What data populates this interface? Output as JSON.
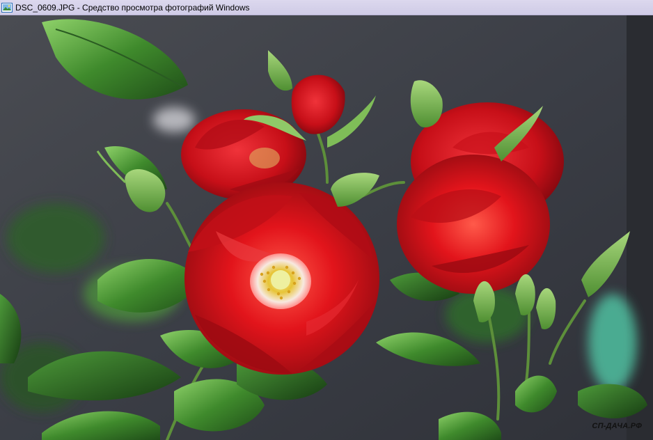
{
  "window": {
    "title": "DSC_0609.JPG - Средство просмотра фотографий Windows",
    "icon": "photo-viewer-icon"
  },
  "photo": {
    "watermark": "СП-ДАЧА.РФ"
  },
  "colors": {
    "titlebar": "#d6d2eb",
    "rose_red": "#d8151c",
    "leaf_green": "#3f8a2c",
    "background": "#3a3d44"
  }
}
